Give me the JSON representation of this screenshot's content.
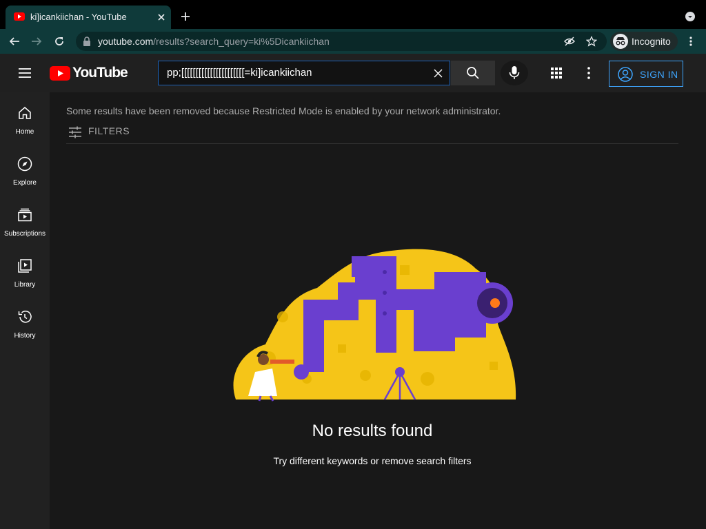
{
  "browser": {
    "tab_title": "ki]icankiichan - YouTube",
    "url_host": "youtube.com",
    "url_path": "/results?search_query=ki%5Dicankiichan",
    "incognito_label": "Incognito"
  },
  "youtube": {
    "logo_text": "YouTube",
    "search_value": "pp;[[[[[[[[[[[[[[[[[[[[[[=ki]icankiichan",
    "signin_label": "SIGN IN"
  },
  "sidebar": {
    "items": [
      {
        "label": "Home",
        "icon": "home-icon"
      },
      {
        "label": "Explore",
        "icon": "compass-icon"
      },
      {
        "label": "Subscriptions",
        "icon": "subscriptions-icon"
      },
      {
        "label": "Library",
        "icon": "library-icon"
      },
      {
        "label": "History",
        "icon": "history-icon"
      }
    ]
  },
  "results": {
    "restricted_notice": "Some results have been removed because Restricted Mode is enabled by your network administrator.",
    "filters_label": "FILTERS",
    "empty_title": "No results found",
    "empty_subtitle": "Try different keywords or remove search filters"
  },
  "colors": {
    "browser_frame": "#0f3a3a",
    "youtube_red": "#ff0000",
    "accent_blue": "#3ea6ff",
    "illustration_yellow": "#f5c518",
    "illustration_purple": "#6a3fcf"
  }
}
